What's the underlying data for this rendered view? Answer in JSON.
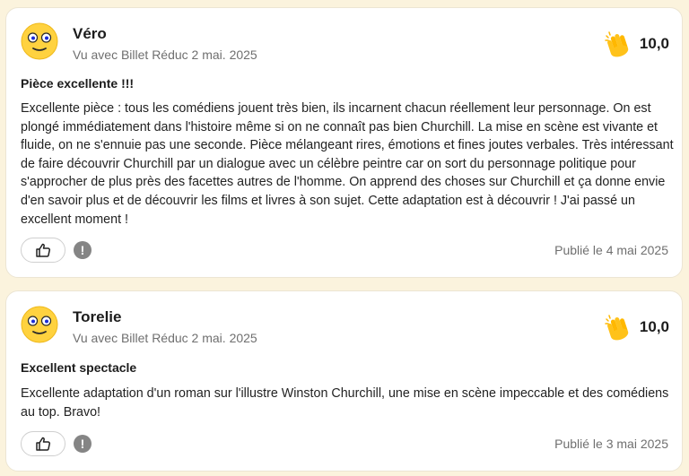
{
  "reviews": [
    {
      "user": "Véro",
      "seen_with": "Vu avec Billet Réduc 2 mai. 2025",
      "rating": "10,0",
      "title": "Pièce excellente !!!",
      "body": "Excellente pièce : tous les comédiens jouent très bien, ils incarnent chacun réellement leur personnage. On est plongé immédiatement dans l'histoire même si on ne connaît pas bien Churchill. La mise en scène est vivante et fluide, on ne s'ennuie pas une seconde. Pièce mélangeant rires, émotions et fines joutes verbales. Très intéressant de faire découvrir Churchill par un dialogue avec un célèbre peintre car on sort du personnage politique pour s'approcher de plus près des facettes autres de l'homme. On apprend des choses sur Churchill et ça donne envie d'en savoir plus et de découvrir les films et livres à son sujet. Cette adaptation est à découvrir ! J'ai passé un excellent moment !",
      "report_symbol": "!",
      "published": "Publié le 4 mai 2025"
    },
    {
      "user": "Torelie",
      "seen_with": "Vu avec Billet Réduc 2 mai. 2025",
      "rating": "10,0",
      "title": "Excellent spectacle",
      "body": "Excellente adaptation d'un roman sur l'illustre Winston Churchill, une mise en scène impeccable et des comédiens au top. Bravo!",
      "report_symbol": "!",
      "published": "Publié le 3 mai 2025"
    }
  ],
  "icons": {
    "avatar": "smiley-face-icon",
    "rating": "clapping-hands-icon",
    "like": "thumbs-up-icon",
    "report": "exclamation-icon"
  },
  "colors": {
    "page_background": "#fbf3dd",
    "card_background": "#ffffff",
    "avatar_yellow": "#ffd23f",
    "clap_yellow": "#ffc21a",
    "muted_text": "#6f6f6f",
    "report_grey": "#858585"
  }
}
